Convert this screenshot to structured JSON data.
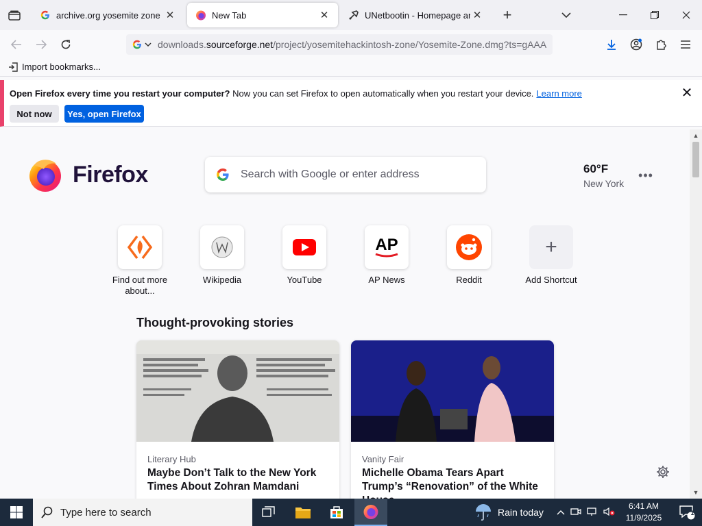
{
  "tabs": [
    {
      "title": "archive.org yosemite zone iso -",
      "icon": "google-g-icon",
      "active": false
    },
    {
      "title": "New Tab",
      "icon": "firefox-icon",
      "active": true
    },
    {
      "title": "UNetbootin - Homepage and D",
      "icon": "unetbootin-icon",
      "active": false
    }
  ],
  "urlbar": {
    "url_prefix": "downloads.",
    "url_domain": "sourceforge.net",
    "url_path": "/project/yosemitehackintosh-zone/Yosemite-Zone.dmg?ts=gAAA"
  },
  "bookmarks": {
    "import_label": "Import bookmarks..."
  },
  "notification": {
    "bold_text": "Open Firefox every time you restart your computer?",
    "text": " Now you can set Firefox to open automatically when you restart your device.",
    "link": "Learn more",
    "not_now": "Not now",
    "yes": "Yes, open Firefox"
  },
  "newtab": {
    "brand": "Firefox",
    "search_placeholder": "Search with Google or enter address",
    "weather_temp": "60°F",
    "weather_city": "New York",
    "shortcuts": [
      {
        "label": "Find out more about..."
      },
      {
        "label": "Wikipedia"
      },
      {
        "label": "YouTube"
      },
      {
        "label": "AP News"
      },
      {
        "label": "Reddit"
      },
      {
        "label": "Add Shortcut"
      }
    ],
    "stories_title": "Thought-provoking stories",
    "stories": [
      {
        "source": "Literary Hub",
        "headline": "Maybe Don’t Talk to the New York Times About Zohran Mamdani"
      },
      {
        "source": "Vanity Fair",
        "headline": "Michelle Obama Tears Apart Trump’s “Renovation” of the White House"
      }
    ]
  },
  "taskbar": {
    "search_placeholder": "Type here to search",
    "weather": "Rain today",
    "time": "6:41 AM",
    "date": "11/9/2025",
    "notification_count": "1"
  },
  "colors": {
    "accent": "#0061e0",
    "notification_border": "#e9426b",
    "taskbar": "#1c2a3c"
  }
}
